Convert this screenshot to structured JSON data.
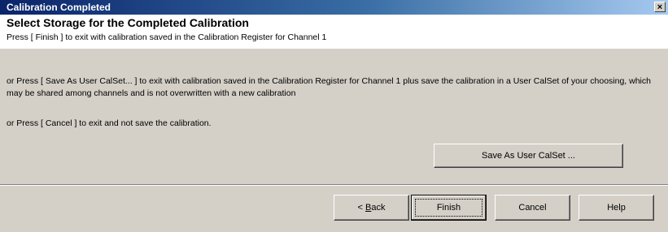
{
  "window": {
    "title": "Calibration Completed",
    "close_glyph": "×"
  },
  "header": {
    "heading": "Select Storage for the Completed Calibration",
    "subtext": "Press [ Finish ] to exit with calibration saved in the Calibration Register for Channel 1"
  },
  "body": {
    "paragraph_1": "or Press [ Save As User CalSet... ] to exit with calibration saved in the Calibration Register for Channel 1 plus save the calibration in a User CalSet of your choosing, which may be shared among channels and is not overwritten with a new calibration",
    "paragraph_2": "or Press [ Cancel ] to exit and not save the calibration."
  },
  "buttons": {
    "save_as_user_calset": "Save As User CalSet ...",
    "back_prefix": "< ",
    "back_accel": "B",
    "back_rest": "ack",
    "finish": "Finish",
    "cancel": "Cancel",
    "help": "Help"
  }
}
